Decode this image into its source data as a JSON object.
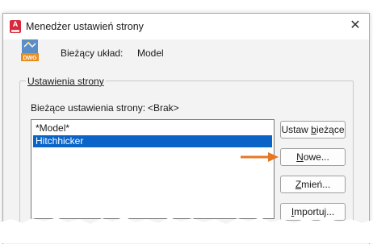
{
  "window": {
    "title": "Menedżer ustawień strony",
    "app_icon_letter": "A",
    "close_symbol": "✕"
  },
  "layout": {
    "icon_text": "DWG",
    "label": "Bieżący układ:",
    "value": "Model"
  },
  "page_setups": {
    "group_label": "Ustawienia strony",
    "current_label": "Bieżące ustawienia strony:",
    "current_value": "<Brak>",
    "items": [
      {
        "label": "*Model*",
        "selected": false
      },
      {
        "label": "Hitchhicker",
        "selected": true
      }
    ]
  },
  "buttons": {
    "set_current": {
      "pre": "Ustaw ",
      "key": "b",
      "post": "ieżące"
    },
    "new": {
      "pre": "",
      "key": "N",
      "post": "owe..."
    },
    "modify": {
      "pre": "",
      "key": "Z",
      "post": "mień..."
    },
    "import": {
      "pre": "",
      "key": "I",
      "post": "mportuj..."
    }
  },
  "colors": {
    "selection": "#0a64c8",
    "arrow": "#e87722",
    "app_icon": "#d8283b"
  }
}
